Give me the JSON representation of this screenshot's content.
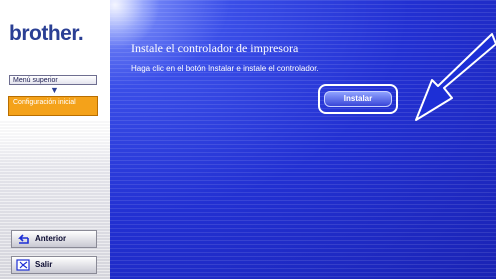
{
  "sidebar": {
    "logo_text": "brother",
    "logo_dot": ".",
    "menu_superior": "Menú superior",
    "configuracion": "Configuración inicial",
    "anterior": "Anterior",
    "salir": "Salir"
  },
  "main": {
    "title": "Instale el controlador de impresora",
    "description": "Haga clic en el botón Instalar e instale el controlador.",
    "install_label": "Instalar"
  },
  "colors": {
    "brand": "#2a3f94",
    "accent_orange": "#f4a21a",
    "background_blue": "#2230d2",
    "arrow_blue": "#1d2fd6"
  },
  "icons": [
    "back-arrow-icon",
    "exit-icon",
    "pointer-arrow-icon",
    "down-arrow-icon"
  ]
}
